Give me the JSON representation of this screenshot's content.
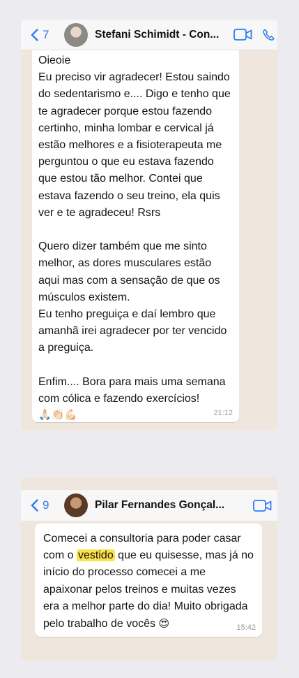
{
  "screens": [
    {
      "back_count": "7",
      "contact_name": "Stefani Schimidt - Con...",
      "icons": [
        "chevron-left-icon",
        "video-call-icon",
        "phone-call-icon"
      ],
      "message": {
        "text": "Oieoie\nEu preciso vir agradecer! Estou saindo do sedentarismo e.... Digo e tenho que te agradecer porque estou fazendo certinho, minha lombar e cervical já estão melhores e a fisioterapeuta me perguntou o que eu estava fazendo que estou tão melhor. Contei que estava fazendo o seu treino, ela quis ver e te agradeceu! Rsrs\n\nQuero dizer também que me sinto melhor, as dores musculares estão aqui mas com a sensação de que os músculos existem.\nEu tenho preguiça e daí lembro que amanhã irei agradecer por ter vencido a preguiça.\n\nEnfim.... Bora para mais uma semana com cólica e fazendo exercícios!",
        "emojis": "🙏🏻👏🏻💪🏻",
        "time": "21:12"
      }
    },
    {
      "back_count": "9",
      "contact_name": "Pilar Fernandes Gonçal...",
      "icons": [
        "chevron-left-icon",
        "video-call-icon"
      ],
      "message": {
        "text_before": "Comecei a consultoria para poder casar com o ",
        "highlight": "vestido",
        "text_after": " que eu quisesse, mas já no início do processo comecei a me apaixonar pelos treinos e muitas vezes era a melhor parte do dia! Muito obrigada pelo trabalho de vocês ",
        "emoji": "😍",
        "time": "15:42"
      }
    }
  ],
  "colors": {
    "page_bg": "#ecebef",
    "chat_bg": "#efe7dd",
    "accent": "#2f7bf5",
    "highlight": "#fbe24a"
  }
}
